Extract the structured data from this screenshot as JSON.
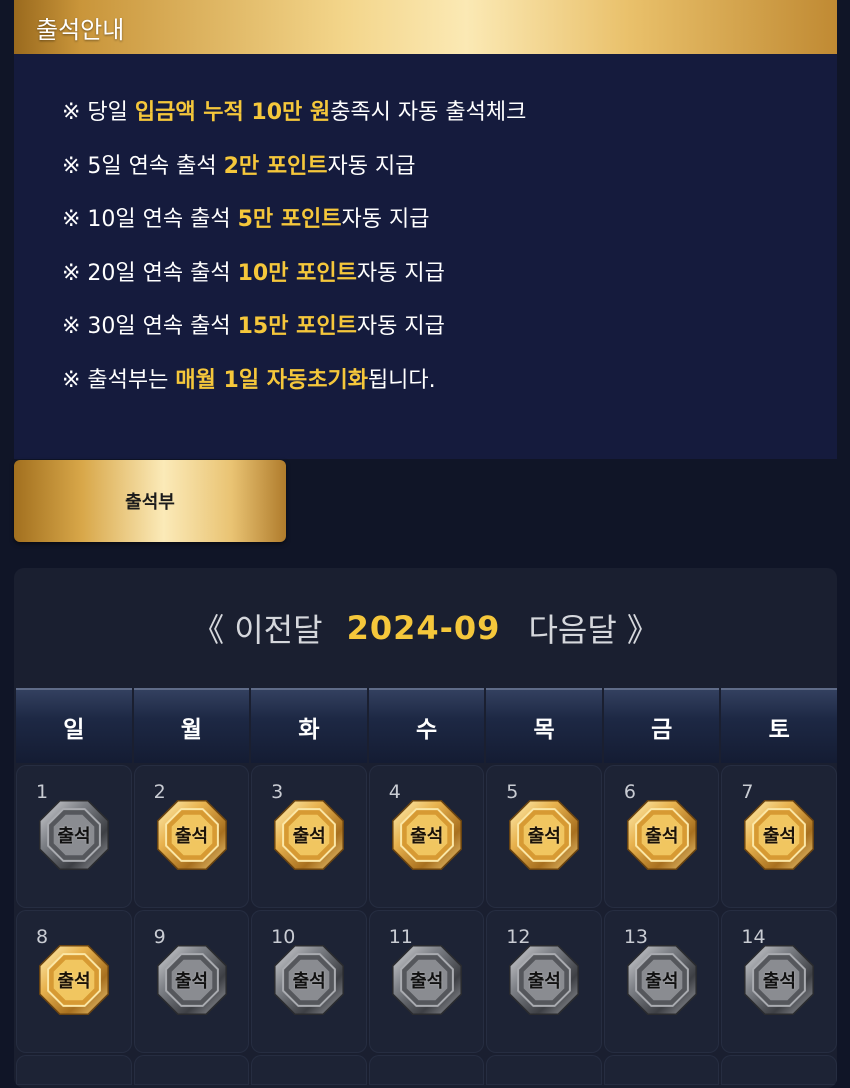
{
  "info": {
    "title": "출석안내",
    "rules": [
      {
        "prefix": "※ 당일 ",
        "highlight": "입금액 누적 10만 원",
        "suffix": "충족시 자동 출석체크"
      },
      {
        "prefix": "※ 5일 연속 출석 ",
        "highlight": "2만 포인트",
        "suffix": "자동 지급"
      },
      {
        "prefix": "※ 10일 연속 출석 ",
        "highlight": "5만 포인트",
        "suffix": "자동 지급"
      },
      {
        "prefix": "※ 20일 연속 출석 ",
        "highlight": "10만 포인트",
        "suffix": "자동 지급"
      },
      {
        "prefix": "※ 30일 연속 출석 ",
        "highlight": "15만 포인트",
        "suffix": "자동 지급"
      },
      {
        "prefix": "※ 출석부는 ",
        "highlight": "매월 1일 자동초기화",
        "suffix": "됩니다."
      }
    ]
  },
  "tab": {
    "label": "출석부"
  },
  "calendar": {
    "prev_label": "《 이전달",
    "month": "2024-09",
    "next_label": "다음달 》",
    "weekdays": [
      "일",
      "월",
      "화",
      "수",
      "목",
      "금",
      "토"
    ],
    "days": [
      {
        "day": "1",
        "stamp": "silver"
      },
      {
        "day": "2",
        "stamp": "gold"
      },
      {
        "day": "3",
        "stamp": "gold"
      },
      {
        "day": "4",
        "stamp": "gold"
      },
      {
        "day": "5",
        "stamp": "gold"
      },
      {
        "day": "6",
        "stamp": "gold"
      },
      {
        "day": "7",
        "stamp": "gold"
      },
      {
        "day": "8",
        "stamp": "gold"
      },
      {
        "day": "9",
        "stamp": "silver"
      },
      {
        "day": "10",
        "stamp": "silver"
      },
      {
        "day": "11",
        "stamp": "silver"
      },
      {
        "day": "12",
        "stamp": "silver"
      },
      {
        "day": "13",
        "stamp": "silver"
      },
      {
        "day": "14",
        "stamp": "silver"
      }
    ],
    "stamp_label": "출석",
    "colors": {
      "gold": "#d9a441",
      "silver": "#6f7177",
      "highlight": "#f5c73b"
    }
  }
}
